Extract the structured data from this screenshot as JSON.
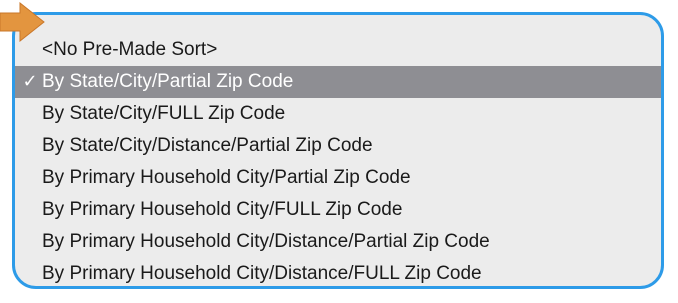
{
  "menu": {
    "items": [
      {
        "label": "<No Pre-Made Sort>",
        "selected": false
      },
      {
        "label": "By State/City/Partial Zip Code",
        "selected": true
      },
      {
        "label": "By State/City/FULL Zip Code",
        "selected": false
      },
      {
        "label": "By State/City/Distance/Partial Zip Code",
        "selected": false
      },
      {
        "label": "By Primary Household City/Partial Zip Code",
        "selected": false
      },
      {
        "label": "By Primary Household City/FULL Zip Code",
        "selected": false
      },
      {
        "label": "By Primary Household City/Distance/Partial Zip Code",
        "selected": false
      },
      {
        "label": "By Primary Household City/Distance/FULL Zip Code",
        "selected": false
      }
    ],
    "check_glyph": "✓"
  },
  "colors": {
    "highlight_border": "#2d9be8",
    "menu_background": "#ececec",
    "selected_background": "#8e8e93",
    "pointer_arrow": "#e3953f"
  },
  "icons": {
    "pointer": "arrow-right-icon",
    "checkmark": "checkmark-icon"
  }
}
